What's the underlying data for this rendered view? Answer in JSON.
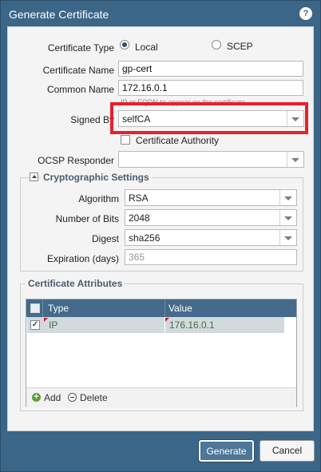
{
  "dialog": {
    "title": "Generate Certificate",
    "help_icon": "?"
  },
  "form": {
    "certificate_type_label": "Certificate Type",
    "certificate_type_options": [
      "Local",
      "SCEP"
    ],
    "certificate_type_selected": "Local",
    "certificate_name_label": "Certificate Name",
    "certificate_name_value": "gp-cert",
    "common_name_label": "Common Name",
    "common_name_value": "172.16.0.1",
    "common_name_hint": "IP or FQDN to appear on the certificate",
    "signed_by_label": "Signed By",
    "signed_by_value": "selfCA",
    "certificate_authority_label": "Certificate Authority",
    "ocsp_responder_label": "OCSP Responder",
    "ocsp_responder_value": ""
  },
  "crypto": {
    "legend": "Cryptographic Settings",
    "algorithm_label": "Algorithm",
    "algorithm_value": "RSA",
    "bits_label": "Number of Bits",
    "bits_value": "2048",
    "digest_label": "Digest",
    "digest_value": "sha256",
    "expiration_label": "Expiration (days)",
    "expiration_value": "365"
  },
  "attributes": {
    "legend": "Certificate Attributes",
    "columns": [
      "Type",
      "Value"
    ],
    "rows": [
      {
        "type": "IP",
        "value": "176.16.0.1",
        "checked": true
      }
    ],
    "add_label": "Add",
    "delete_label": "Delete"
  },
  "footer": {
    "generate_label": "Generate",
    "cancel_label": "Cancel"
  },
  "colors": {
    "title_bar": "#3b6688",
    "highlight": "#e8212a",
    "grid_header": "#456a8b"
  }
}
